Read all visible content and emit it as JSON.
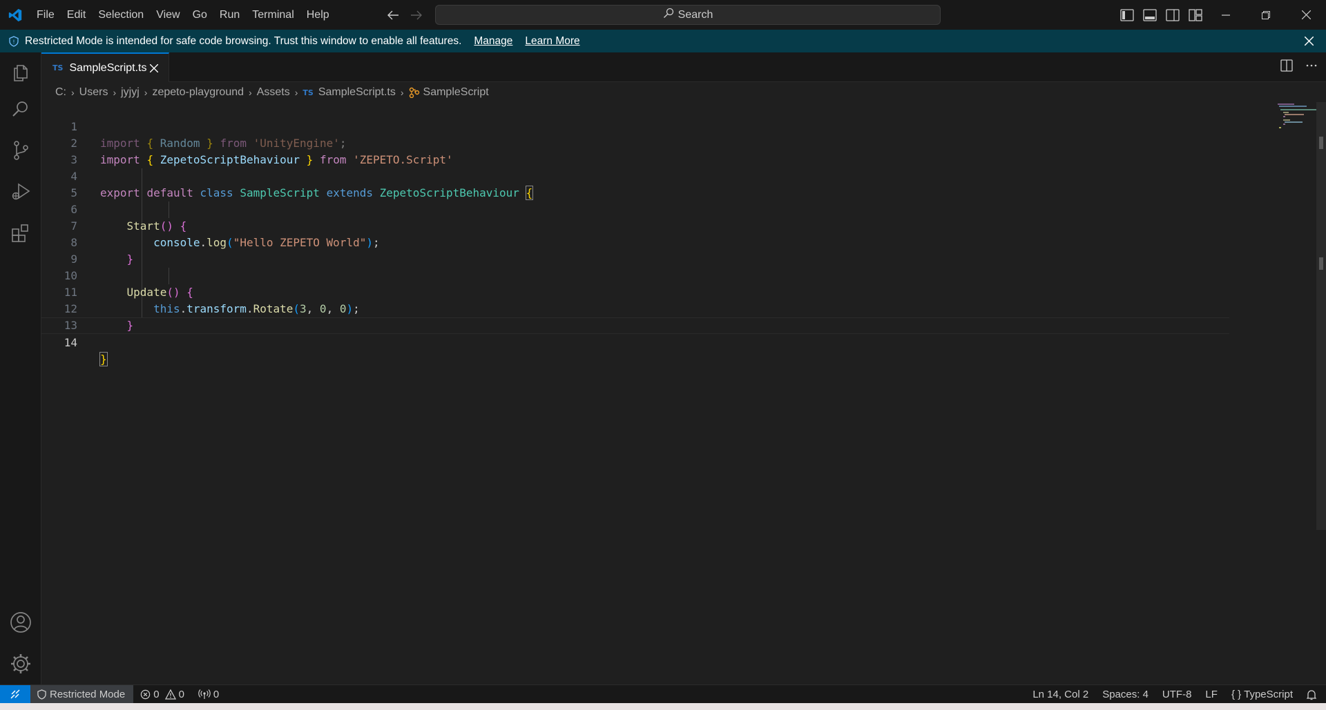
{
  "menu": [
    "File",
    "Edit",
    "Selection",
    "View",
    "Go",
    "Run",
    "Terminal",
    "Help"
  ],
  "search": {
    "label": "Search"
  },
  "banner": {
    "message": "Restricted Mode is intended for safe code browsing. Trust this window to enable all features.",
    "manage": "Manage",
    "learn_more": "Learn More"
  },
  "tab": {
    "badge": "TS",
    "filename": "SampleScript.ts"
  },
  "breadcrumbs": [
    "C:",
    "Users",
    "jyjyj",
    "zepeto-playground",
    "Assets",
    "SampleScript.ts",
    "SampleScript"
  ],
  "code_lines": [
    "import { Random } from 'UnityEngine';",
    "import { ZepetoScriptBehaviour } from 'ZEPETO.Script'",
    "",
    "export default class SampleScript extends ZepetoScriptBehaviour {",
    "",
    "    Start() {",
    "        console.log(\"Hello ZEPETO World\");",
    "    }",
    "",
    "    Update() {",
    "        this.transform.Rotate(3, 0, 0);",
    "    }",
    "",
    "}"
  ],
  "line_numbers": [
    "1",
    "2",
    "3",
    "4",
    "5",
    "6",
    "7",
    "8",
    "9",
    "10",
    "11",
    "12",
    "13",
    "14"
  ],
  "status": {
    "restricted_mode": "Restricted Mode",
    "errors": "0",
    "warnings": "0",
    "ports": "0",
    "position": "Ln 14, Col 2",
    "spaces": "Spaces: 4",
    "encoding": "UTF-8",
    "eol": "LF",
    "language": "TypeScript"
  },
  "colors": {
    "accent": "#0078d4",
    "banner_bg": "#063b49",
    "editor_bg": "#1f1f1f"
  }
}
